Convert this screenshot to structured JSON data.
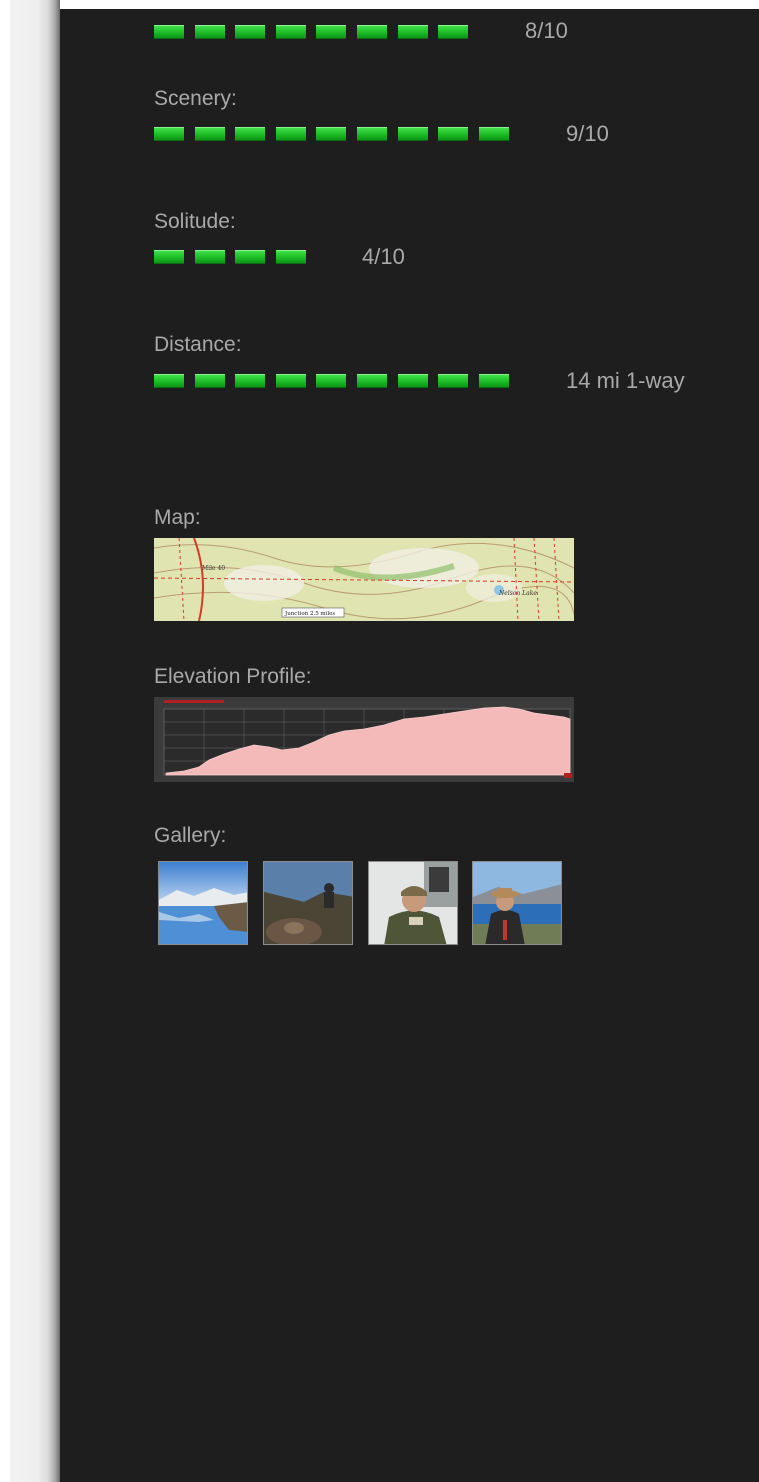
{
  "ratings": [
    {
      "label": "",
      "filled": 8,
      "score": "8/10"
    },
    {
      "label": "Scenery:",
      "filled": 9,
      "score": "9/10"
    },
    {
      "label": "Solitude:",
      "filled": 4,
      "score": "4/10"
    },
    {
      "label": "Distance:",
      "filled": 9,
      "score": "14 mi 1-way"
    }
  ],
  "map": {
    "heading": "Map:",
    "text_mile": "Mile 40",
    "text_lake": "Nelson Lake",
    "text_scale": "Junction 2.5 miles"
  },
  "elevation": {
    "heading": "Elevation Profile:"
  },
  "gallery": {
    "heading": "Gallery:",
    "thumbnails": [
      "lake-reflection-photo",
      "campfire-photo",
      "tent-portrait-photo",
      "lake-portrait-photo"
    ]
  },
  "colors": {
    "panel_bg": "#1e1e1e",
    "text": "#a9a9a9",
    "bar_green": "#19b823"
  }
}
